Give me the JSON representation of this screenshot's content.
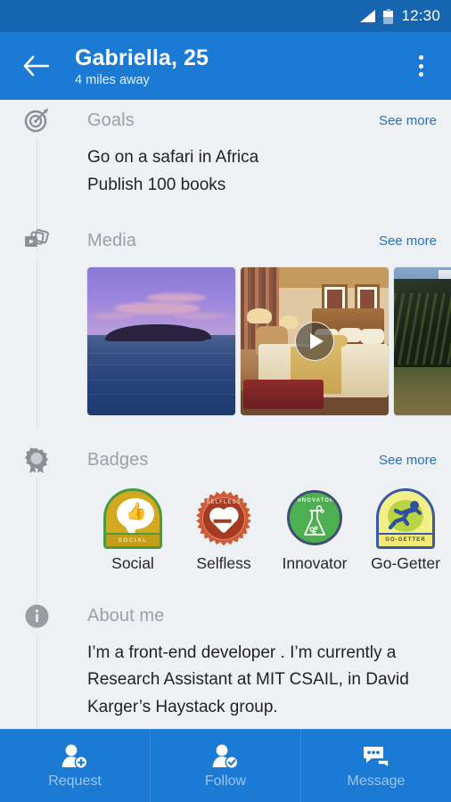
{
  "statusbar": {
    "time": "12:30",
    "signal_icon": "signal-triangle-icon",
    "battery_icon": "battery-icon"
  },
  "appbar": {
    "back_icon": "back-arrow-icon",
    "title": "Gabriella, 25",
    "subtitle": "4 miles away",
    "overflow_icon": "more-vertical-icon",
    "background": "#1b7ad4"
  },
  "sections": {
    "goals": {
      "icon": "target-icon",
      "title": "Goals",
      "see_more": "See more",
      "items": [
        "Go on a safari in Africa",
        "Publish 100 books"
      ]
    },
    "media": {
      "icon": "media-stack-icon",
      "title": "Media",
      "see_more": "See more",
      "items": [
        {
          "name": "sunset-island-photo",
          "type": "photo"
        },
        {
          "name": "hotel-room-video",
          "type": "video",
          "play_icon": "play-icon"
        },
        {
          "name": "mountain-lake-photo",
          "type": "photo"
        }
      ]
    },
    "badges": {
      "icon": "award-rosette-icon",
      "title": "Badges",
      "see_more": "See more",
      "items": [
        {
          "label": "Social",
          "inner_text": "SOCIAL",
          "glyph": "thumbs-up-icon",
          "colors": {
            "border": "#4a9a3f",
            "fill": "#d4a81f"
          }
        },
        {
          "label": "Selfless",
          "inner_text": "SELFLESS",
          "glyph": "heart-icon",
          "colors": {
            "border": "#cf5a36",
            "fill": "#a63a22"
          }
        },
        {
          "label": "Innovator",
          "inner_text": "INNOVATOR",
          "glyph": "flask-icon",
          "colors": {
            "border": "#3f4d72",
            "fill": "#4caf50"
          }
        },
        {
          "label": "Go-Getter",
          "inner_text": "GO-GETTER",
          "glyph": "runner-icon",
          "colors": {
            "border": "#3b57a6",
            "fill": "#f2ef86"
          }
        }
      ]
    },
    "about": {
      "icon": "info-icon",
      "title": "About me",
      "text": "I’m a front-end developer . I’m currently a Research Assistant at MIT CSAIL, in David Karger’s Haystack group."
    }
  },
  "bottombar": {
    "actions": [
      {
        "label": "Request",
        "icon": "person-add-icon"
      },
      {
        "label": "Follow",
        "icon": "person-check-icon"
      },
      {
        "label": "Message",
        "icon": "chat-bubbles-icon"
      }
    ]
  }
}
